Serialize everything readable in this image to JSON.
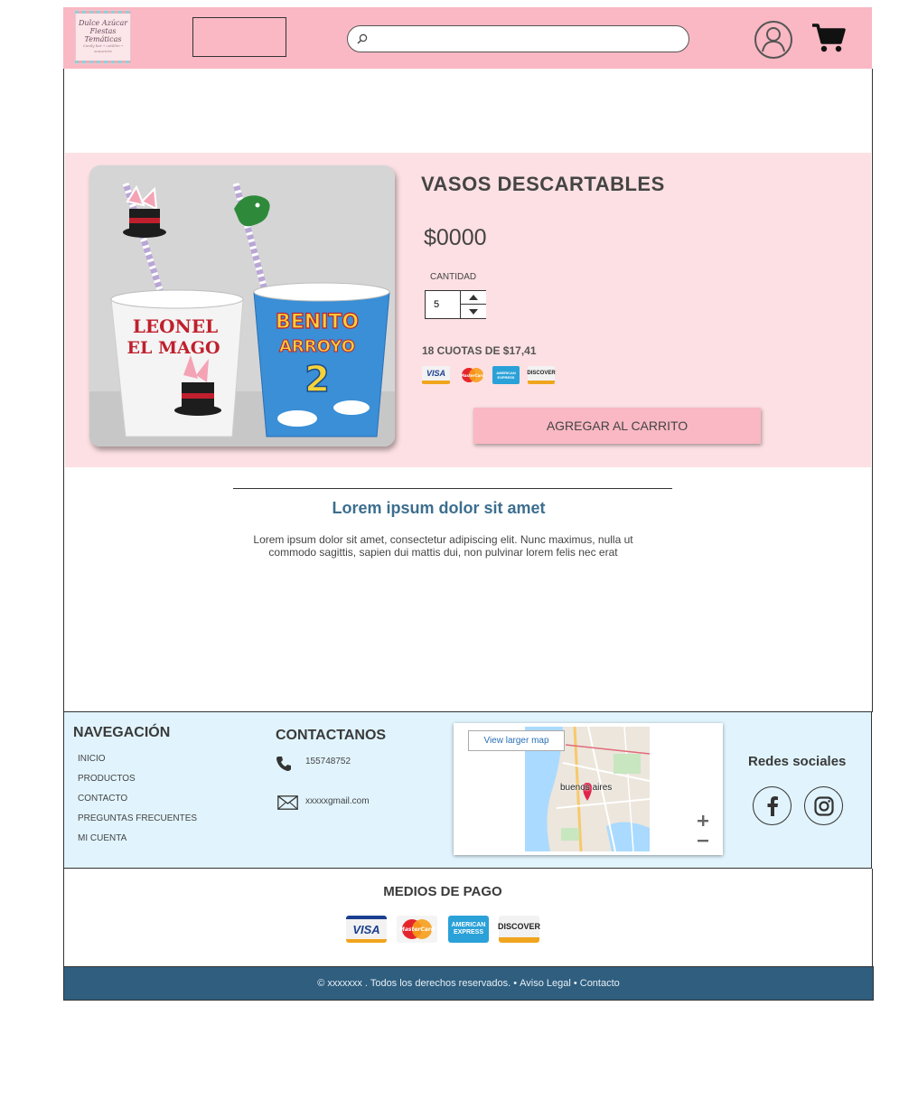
{
  "header": {
    "logo_lines": [
      "Dulce Azúcar",
      "Fiestas Temáticas",
      "Candy bar • cotillón • souvenirs"
    ],
    "search_placeholder": ""
  },
  "product": {
    "title": "VASOS DESCARTABLES",
    "price": "$0000",
    "quantity_label": "CANTIDAD",
    "quantity_value": "5",
    "installments": "18 CUOTAS DE $17,41",
    "cards": [
      "VISA",
      "MasterCard",
      "AMERICAN EXPRESS",
      "DISCOVER"
    ],
    "image_cup_texts": [
      "LEONEL",
      "EL MAGO",
      "BENITO",
      "ARROYO",
      "2"
    ],
    "add_to_cart": "AGREGAR AL CARRITO"
  },
  "info": {
    "title": "Lorem ipsum dolor sit amet",
    "text": "Lorem ipsum dolor sit amet, consectetur adipiscing elit. Nunc maximus, nulla ut commodo sagittis, sapien dui mattis dui, non pulvinar lorem felis nec erat"
  },
  "footer": {
    "nav_title": "NAVEGACIÓN",
    "nav_items": [
      "INICIO",
      "PRODUCTOS",
      "CONTACTO",
      "PREGUNTAS FRECUENTES",
      "MI CUENTA"
    ],
    "contact_title": "CONTACTANOS",
    "phone": "155748752",
    "email": "xxxxxgmail.com",
    "map_link": "View larger map",
    "map_place": "buenos aires",
    "social_title": "Redes sociales",
    "social_icons": [
      "facebook-icon",
      "instagram-icon"
    ]
  },
  "payments": {
    "title": "MEDIOS DE PAGO",
    "cards": [
      "VISA",
      "MasterCard",
      "AMERICAN EXPRESS",
      "DISCOVER"
    ]
  },
  "bottom": {
    "copyright": "© xxxxxxx . Todos los derechos reservados. • ",
    "legal": "Aviso Legal",
    "sep": " • ",
    "contact": "Contacto"
  },
  "colors": {
    "header": "#f9b8c3",
    "product_bg": "#fde0e3",
    "footer_bg": "#e1f4fd",
    "bottom_bar": "#2f5e7f",
    "accent_title": "#3c6e8f"
  }
}
